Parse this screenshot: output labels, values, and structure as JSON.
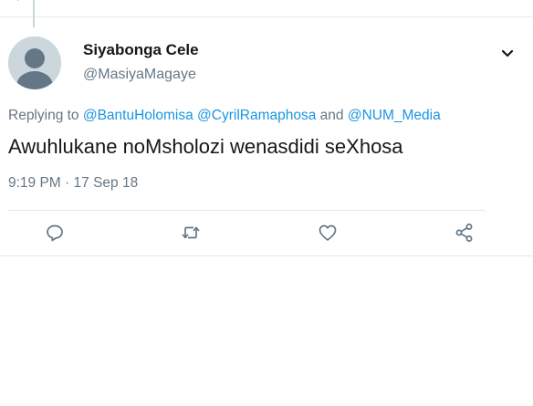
{
  "tweet": {
    "author": {
      "display_name": "Siyabonga Cele",
      "handle": "@MasiyaMagaye"
    },
    "reply": {
      "prefix": "Replying to",
      "mentions": [
        "@BantuHolomisa",
        "@CyrilRamaphosa",
        "@NUM_Media"
      ],
      "joiner": "and"
    },
    "text": "Awuhlukane noMsholozi wenasdidi seXhosa",
    "time": "9:19 PM",
    "separator": "·",
    "date": "17 Sep 18"
  },
  "actions": [
    {
      "name": "reply",
      "icon": "reply-icon"
    },
    {
      "name": "retweet",
      "icon": "retweet-icon"
    },
    {
      "name": "like",
      "icon": "heart-icon"
    },
    {
      "name": "share",
      "icon": "share-icon"
    }
  ],
  "colors": {
    "link": "#1b95e0",
    "secondary_text": "#657786",
    "primary_text": "#14171a",
    "icon": "#657786",
    "divider": "#e1e8ed",
    "avatar_bg": "#ccd6dd"
  }
}
